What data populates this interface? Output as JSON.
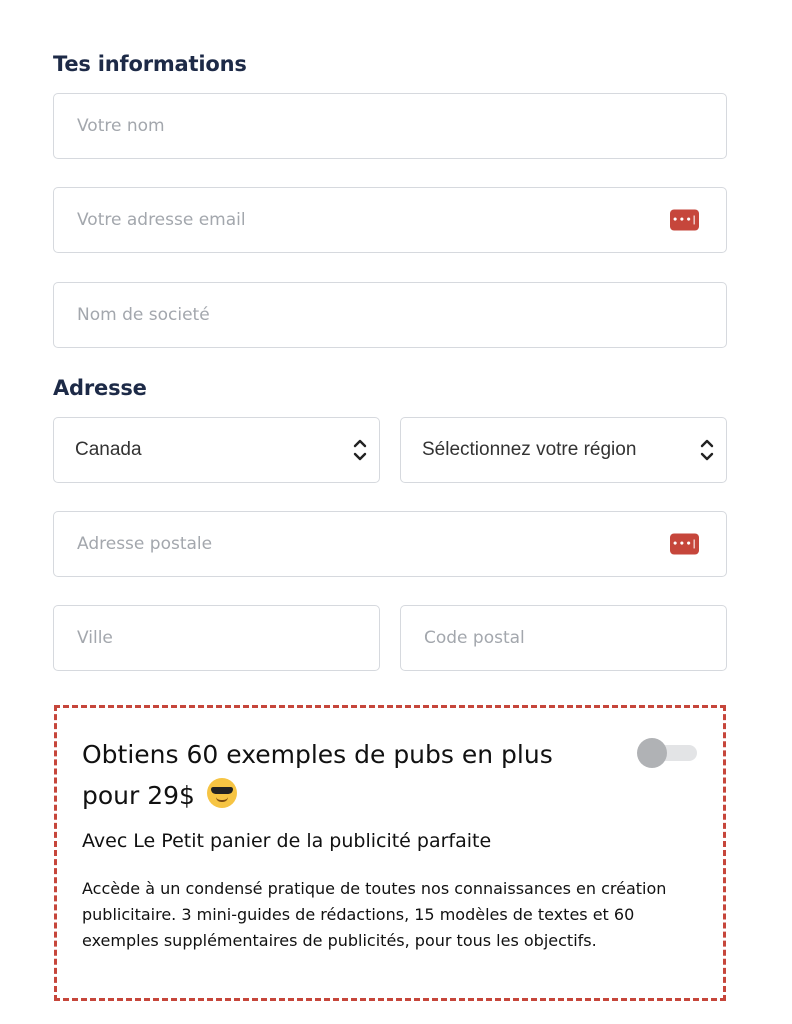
{
  "info_section": {
    "title": "Tes informations",
    "name_placeholder": "Votre nom",
    "email_placeholder": "Votre adresse email",
    "company_placeholder": "Nom de societé"
  },
  "address_section": {
    "title": "Adresse",
    "country_value": "Canada",
    "region_value": "Sélectionnez votre région",
    "street_placeholder": "Adresse postale",
    "city_placeholder": "Ville",
    "postal_placeholder": "Code postal"
  },
  "icons": {
    "password_manager": "password-manager-icon",
    "select_arrows": "chevron-up-down-icon",
    "emoji": "sunglasses-emoji-icon"
  },
  "promo": {
    "title": "Obtiens 60 exemples de pubs en plus pour 29$",
    "subtitle": "Avec Le Petit panier de la publicité parfaite",
    "description": "Accède à un condensé pratique de toutes nos connaissances en création publicitaire. 3 mini-guides de rédactions, 15 modèles de textes et 60 exemples supplémentaires de publicités, pour tous les objectifs.",
    "toggle_on": false
  },
  "colors": {
    "accent": "#c6463b",
    "heading": "#1d2a47",
    "border": "#d6d9de"
  }
}
